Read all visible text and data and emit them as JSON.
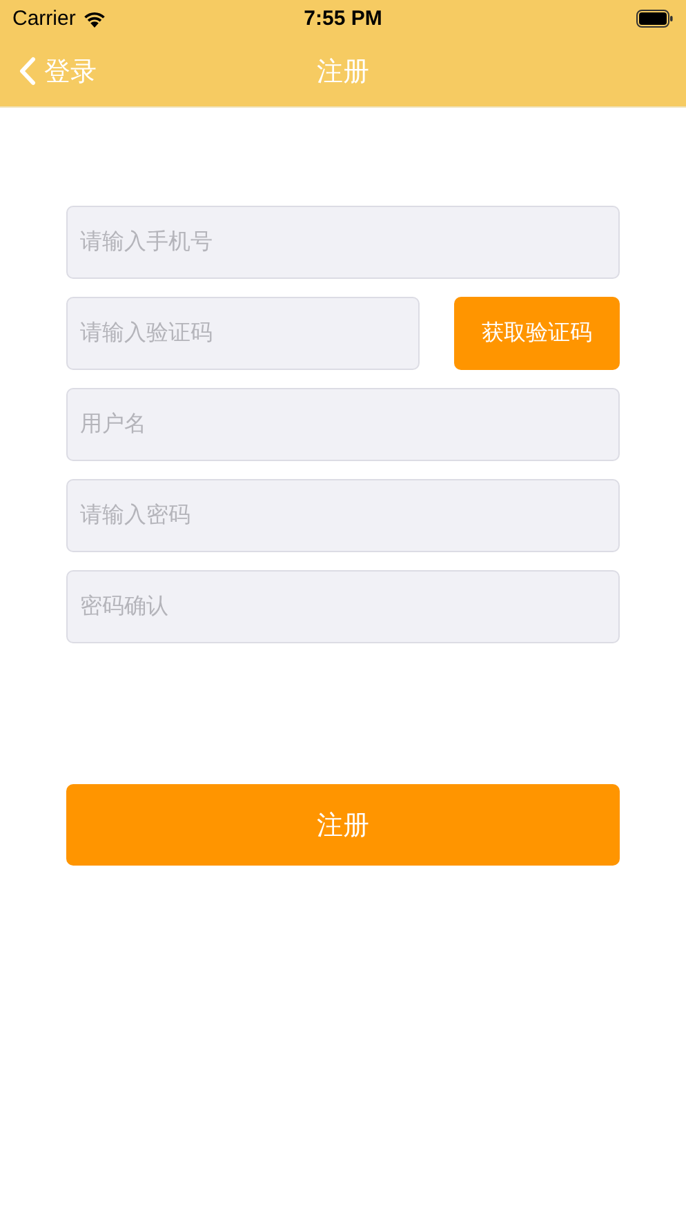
{
  "status_bar": {
    "carrier": "Carrier",
    "time": "7:55 PM"
  },
  "nav": {
    "back_label": "登录",
    "title": "注册"
  },
  "fields": [
    {
      "kind": "text",
      "placeholder": "请输入手机号"
    },
    {
      "kind": "code",
      "placeholder": "请输入验证码",
      "button": "获取验证码"
    },
    {
      "kind": "text",
      "placeholder": "用户名"
    },
    {
      "kind": "text",
      "placeholder": "请输入密码"
    },
    {
      "kind": "text",
      "placeholder": "密码确认"
    }
  ],
  "submit": "注册"
}
